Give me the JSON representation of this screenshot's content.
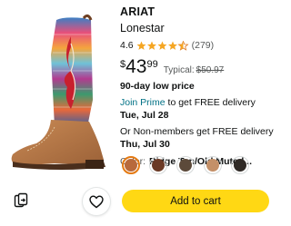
{
  "product": {
    "brand": "ARIAT",
    "name": "Lonestar",
    "rating_value": "4.6",
    "rating_stars": 4.5,
    "rating_count": "(279)",
    "price": {
      "currency": "$",
      "whole": "43",
      "fraction": "99",
      "typical_label": "Typical:",
      "typical_price": "$50.97"
    },
    "deal_label": "90-day low price",
    "delivery": {
      "prime_link": "Join Prime",
      "prime_text": " to get FREE delivery ",
      "prime_date": "Tue, Jul 28",
      "nonmember_text": "Or Non-members get FREE delivery ",
      "nonmember_date": "Thu, Jul 30"
    },
    "color_label": "Color:",
    "color_value": "Ridge Tan/Old Muted...",
    "swatches": [
      {
        "name": "Ridge Tan/Old Muted",
        "color": "#b8693c",
        "selected": true
      },
      {
        "name": "Brown",
        "color": "#6b3a26",
        "selected": false
      },
      {
        "name": "Dark Brown",
        "color": "#5c4a3a",
        "selected": false
      },
      {
        "name": "Tan",
        "color": "#c49068",
        "selected": false
      },
      {
        "name": "Black",
        "color": "#2f2a26",
        "selected": false
      }
    ]
  },
  "actions": {
    "add_to_cart": "Add to cart"
  },
  "icons": {
    "share": "share-icon",
    "wishlist": "heart-icon",
    "star": "star-icon"
  },
  "colors": {
    "star": "#f5a623",
    "link": "#007185",
    "cart_button": "#ffd814",
    "swatch_selected_border": "#e47911"
  }
}
